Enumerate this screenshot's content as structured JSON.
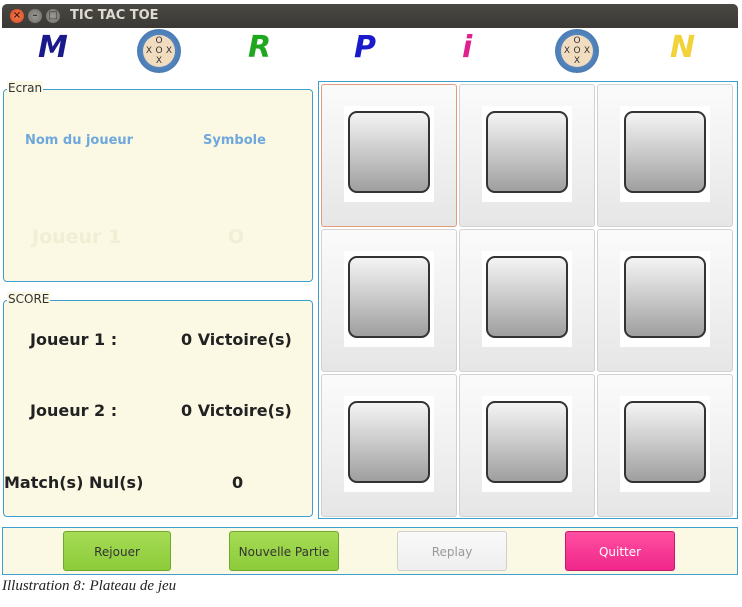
{
  "window": {
    "title": "TIC TAC TOE"
  },
  "banner": {
    "letters": [
      {
        "text": "M",
        "color": "#1a1a8c"
      },
      {
        "text": "R",
        "color": "#1fa81f"
      },
      {
        "text": "P",
        "color": "#1a1acc"
      },
      {
        "text": "i",
        "color": "#e0208f"
      },
      {
        "text": "N",
        "color": "#f2d23a"
      }
    ],
    "logo_cells": [
      "",
      "O",
      "",
      "X",
      "O",
      "X",
      "",
      "X",
      ""
    ]
  },
  "ecran": {
    "legend": "Ecran",
    "col_player": "Nom du joueur",
    "col_symbol": "Symbole",
    "current_player": "Joueur 1",
    "current_symbol": "O"
  },
  "score": {
    "legend": "SCORE",
    "player1_label": "Joueur 1 :",
    "player1_value": "0 Victoire(s)",
    "player2_label": "Joueur 2 :",
    "player2_value": "0 Victoire(s)",
    "draws_label": "Match(s) Nul(s)",
    "draws_value": "0"
  },
  "board": {
    "cells": [
      "",
      "",
      "",
      "",
      "",
      "",
      "",
      "",
      ""
    ]
  },
  "buttons": {
    "rejouer": "Rejouer",
    "nouvelle_partie": "Nouvelle Partie",
    "replay": "Replay",
    "quitter": "Quitter"
  },
  "caption": "Illustration 8: Plateau de jeu",
  "colors": {
    "panel_bg": "#fbf9e4",
    "border_accent": "#3d9fd0",
    "green_button": "#9dd64a",
    "pink_button": "#f7378f"
  }
}
